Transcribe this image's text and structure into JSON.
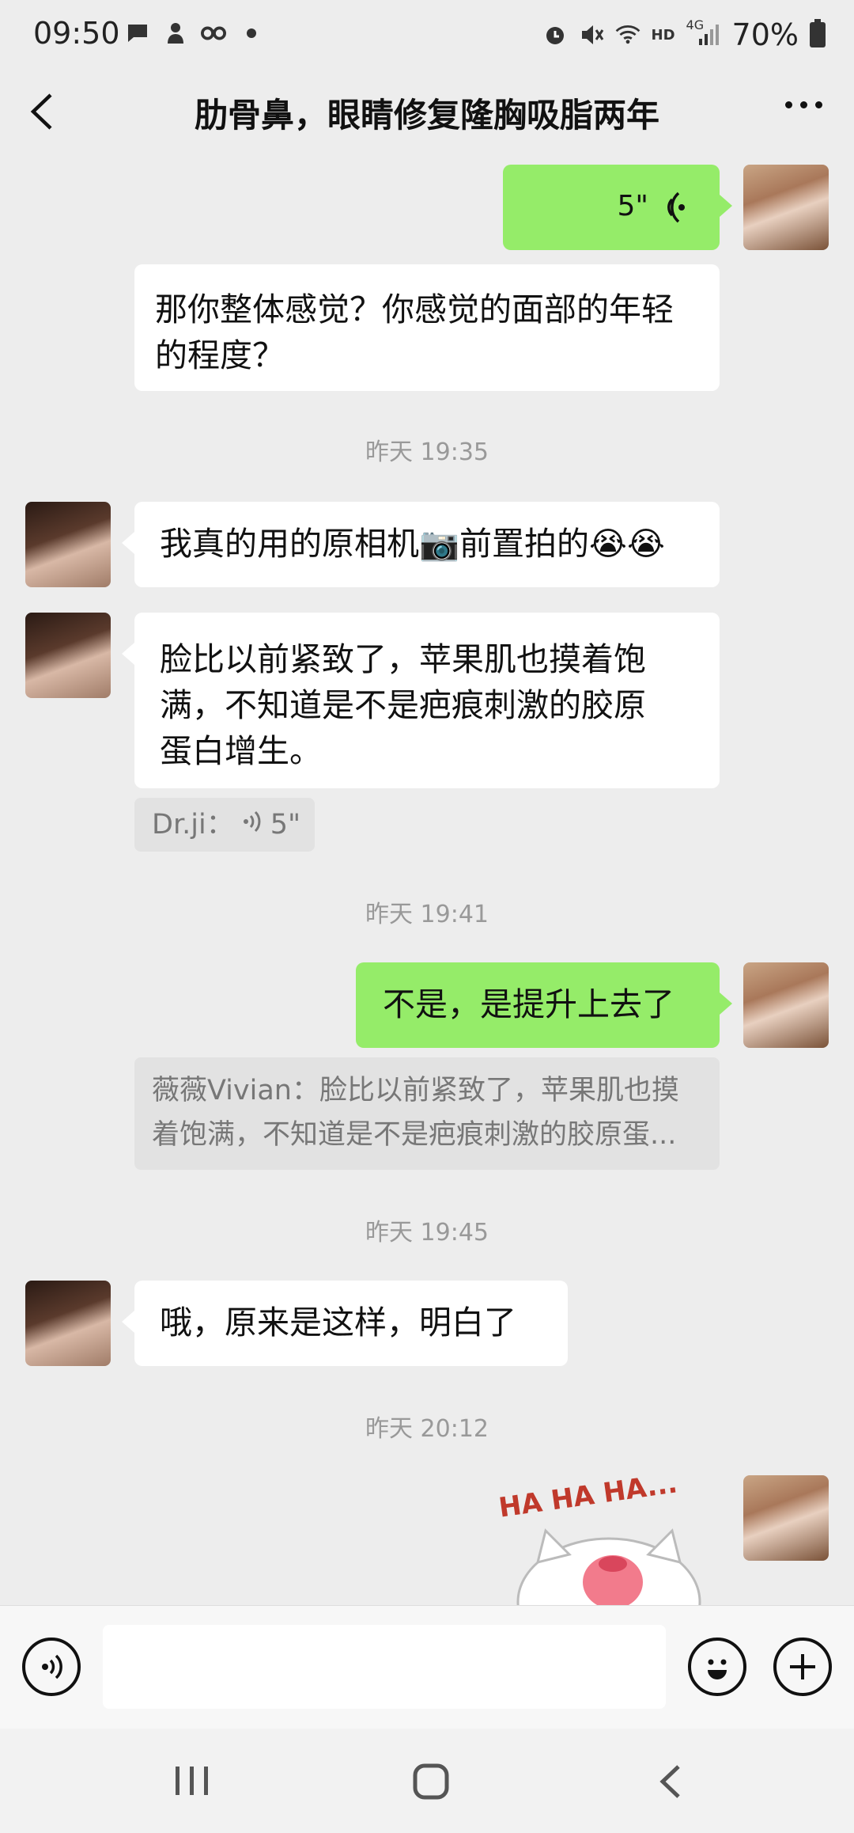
{
  "status_bar": {
    "time": "09:50",
    "battery": "70%",
    "network": "4G",
    "hd": "HD",
    "icons_left": [
      "message-icon",
      "app-icon",
      "infinity-icon"
    ],
    "icons_right": [
      "alarm-icon",
      "mute-icon",
      "wifi-icon",
      "signal-icon",
      "battery-icon"
    ]
  },
  "header": {
    "title": "肋骨鼻，眼睛修复隆胸吸脂两年"
  },
  "messages": {
    "voice_out": {
      "duration": "5\""
    },
    "msg1": {
      "line1": "那你整体感觉？你感觉的面部的年轻",
      "line2": "的程度？"
    },
    "ts1": "昨天 19:35",
    "msg2": {
      "text": "我真的用的原相机📷前置拍的😭😭"
    },
    "msg3": {
      "line1": "脸比以前紧致了，苹果肌也摸着饱",
      "line2": "满，不知道是不是疤痕刺激的胶原",
      "line3": "蛋白增生。"
    },
    "voice_quote": {
      "sender": "Dr.ji：",
      "duration": "5\""
    },
    "ts2": "昨天 19:41",
    "msg4": {
      "text": "不是，是提升上去了"
    },
    "quote2": {
      "line1": "薇薇Vivian：脸比以前紧致了，苹果肌也摸",
      "line2": "着饱满，不知道是不是疤痕刺激的胶原蛋..."
    },
    "ts3": "昨天 19:45",
    "msg5": {
      "text": "哦，原来是这样，明白了"
    },
    "ts4": "昨天 20:12",
    "sticker": {
      "text": "HA HA HA..."
    }
  },
  "colors": {
    "background": "#ededed",
    "bubble_out": "#95ec69",
    "bubble_in": "#ffffff"
  }
}
